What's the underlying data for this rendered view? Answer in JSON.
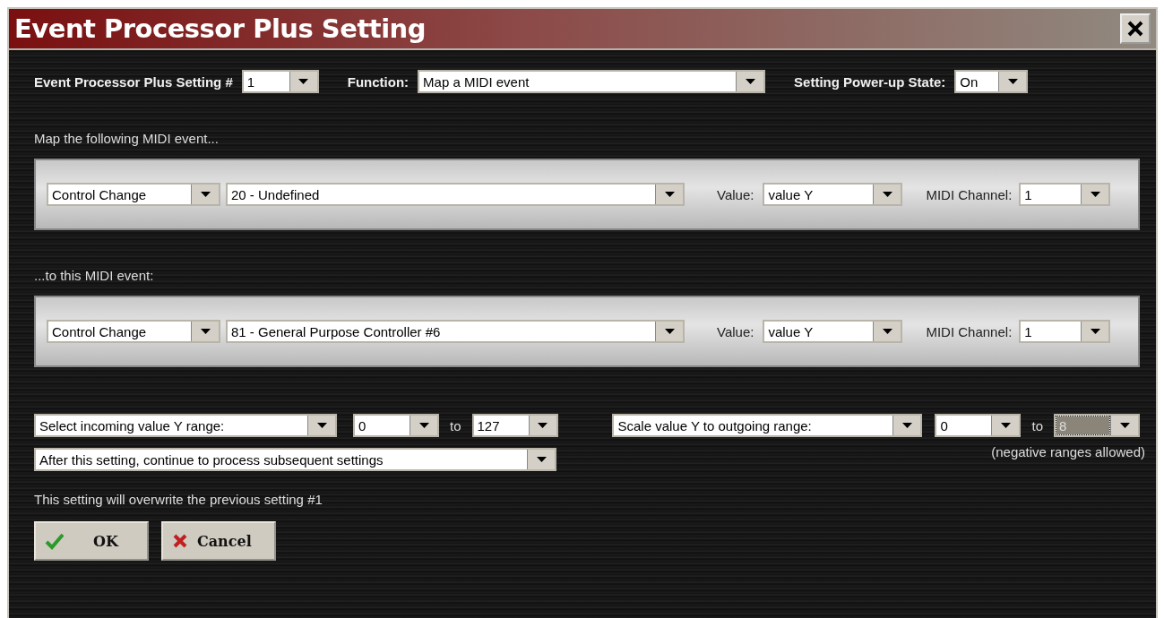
{
  "window": {
    "title": "Event Processor Plus Setting"
  },
  "header": [
    {
      "label": "Event Processor Plus Setting #",
      "value": "1"
    },
    {
      "label": "Function:",
      "value": "Map a MIDI event"
    },
    {
      "label": "Setting Power-up State:",
      "value": "On"
    }
  ],
  "events": [
    {
      "caption": "Map the following MIDI event...",
      "type": "Control Change",
      "controller": "20 - Undefined",
      "value_label": "Value:",
      "value": "value Y",
      "channel_label": "MIDI Channel:",
      "channel": "1"
    },
    {
      "caption": "...to this MIDI event:",
      "type": "Control Change",
      "controller": "81 - General Purpose Controller #6",
      "value_label": "Value:",
      "value": "value Y",
      "channel_label": "MIDI Channel:",
      "channel": "1"
    }
  ],
  "incoming_range": {
    "mode": "Select incoming value Y range:",
    "from": "0",
    "to_label": "to",
    "to": "127",
    "to_focused": false
  },
  "outgoing_range": {
    "mode": "Scale value Y to outgoing range:",
    "from": "0",
    "to_label": "to",
    "to": "8",
    "to_focused": true,
    "note": "(negative ranges allowed)"
  },
  "continuation": "After this setting, continue to process subsequent settings",
  "message": "This setting will overwrite the previous setting #1",
  "buttons": [
    {
      "label": "OK",
      "kind": "ok"
    },
    {
      "label": "Cancel",
      "kind": "cancel"
    }
  ]
}
